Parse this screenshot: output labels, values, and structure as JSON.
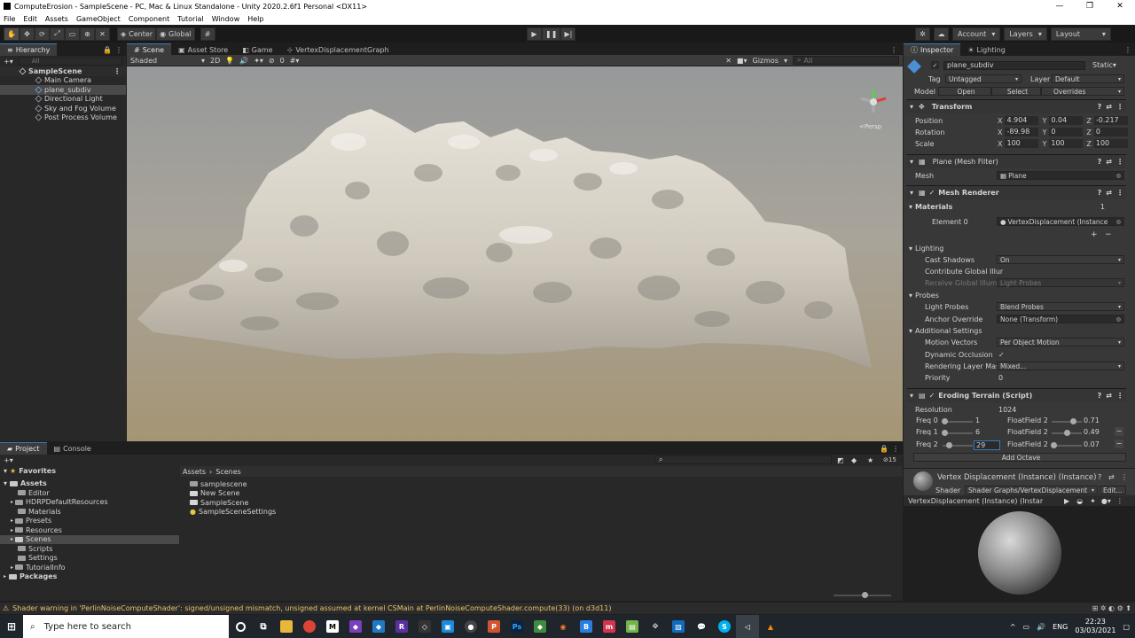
{
  "window": {
    "title": "ComputeErosion - SampleScene - PC, Mac & Linux Standalone - Unity 2020.2.6f1 Personal <DX11>"
  },
  "menu": [
    "File",
    "Edit",
    "Assets",
    "GameObject",
    "Component",
    "Tutorial",
    "Window",
    "Help"
  ],
  "toolbar": {
    "pivot": "Center",
    "space": "Global",
    "account": "Account",
    "layers": "Layers",
    "layout": "Layout"
  },
  "hierarchy": {
    "tab": "Hierarchy",
    "search": "All",
    "scene": "SampleScene",
    "items": [
      "Main Camera",
      "plane_subdiv",
      "Directional Light",
      "Sky and Fog Volume",
      "Post Process Volume"
    ]
  },
  "scene_tabs": [
    "Scene",
    "Asset Store",
    "Game",
    "VertexDisplacementGraph"
  ],
  "scene_toolbar": {
    "shading": "Shaded",
    "mode": "2D",
    "layers_count": "0",
    "gizmos": "Gizmos",
    "search": "All",
    "persp": "<Persp"
  },
  "project": {
    "tabs": [
      "Project",
      "Console"
    ],
    "favorites": "Favorites",
    "assets": "Assets",
    "folders": [
      "Editor",
      "HDRPDefaultResources",
      "Materials",
      "Presets",
      "Resources",
      "Scenes",
      "Scripts",
      "Settings",
      "TutorialInfo"
    ],
    "packages": "Packages",
    "breadcrumb": [
      "Assets",
      "Scenes"
    ],
    "files": [
      "samplescene",
      "New Scene",
      "SampleScene",
      "SampleSceneSettings"
    ],
    "count": "15"
  },
  "inspector": {
    "tabs": [
      "Inspector",
      "Lighting"
    ],
    "object": "plane_subdiv",
    "static": "Static",
    "tag_label": "Tag",
    "tag": "Untagged",
    "layer_label": "Layer",
    "layer": "Default",
    "model_label": "Model",
    "open": "Open",
    "select": "Select",
    "overrides": "Overrides",
    "transform": {
      "title": "Transform",
      "rows": [
        {
          "label": "Position",
          "x": "4.904",
          "y": "0.04",
          "z": "-0.217"
        },
        {
          "label": "Rotation",
          "x": "-89.98",
          "y": "0",
          "z": "0"
        },
        {
          "label": "Scale",
          "x": "100",
          "y": "100",
          "z": "100"
        }
      ]
    },
    "meshfilter": {
      "title": "Plane (Mesh Filter)",
      "mesh_label": "Mesh",
      "mesh": "Plane"
    },
    "renderer": {
      "title": "Mesh Renderer",
      "materials": "Materials",
      "mat_count": "1",
      "element": "Element 0",
      "element_val": "VertexDisplacement (Instance",
      "lighting": "Lighting",
      "cast_shadows": "Cast Shadows",
      "cast_val": "On",
      "contribute": "Contribute Global Illur",
      "receive": "Receive Global Illumi",
      "receive_val": "Light Probes",
      "probes": "Probes",
      "light_probes": "Light Probes",
      "lp_val": "Blend Probes",
      "anchor": "Anchor Override",
      "anchor_val": "None (Transform)",
      "additional": "Additional Settings",
      "motion": "Motion Vectors",
      "motion_val": "Per Object Motion",
      "dynocc": "Dynamic Occlusion",
      "rlm": "Rendering Layer Mas",
      "rlm_val": "Mixed...",
      "priority": "Priority",
      "priority_val": "0"
    },
    "script": {
      "title": "Eroding Terrain (Script)",
      "res_label": "Resolution",
      "res": "1024",
      "freqs": [
        {
          "label": "Freq 0",
          "val": "1",
          "ff": "FloatField 2",
          "ffv": "0.71",
          "s": 0.05,
          "fs": 0.71
        },
        {
          "label": "Freq 1",
          "val": "6",
          "ff": "FloatField 2",
          "ffv": "0.49",
          "s": 0.05,
          "fs": 0.49
        },
        {
          "label": "Freq 2",
          "val": "29",
          "ff": "FloatField 2",
          "ffv": "0.07",
          "s": 0.2,
          "fs": 0.07
        }
      ],
      "add": "Add Octave"
    },
    "material": {
      "title": "Vertex Displacement (Instance) (Instance)",
      "shader_label": "Shader",
      "shader": "Shader Graphs/VertexDisplacement",
      "edit": "Edit..."
    },
    "preview": "VertexDisplacement (Instance) (Instar"
  },
  "status": "Shader warning in 'PerlinNoiseComputeShader': signed/unsigned mismatch, unsigned assumed at kernel CSMain at PerlinNoiseComputeShader.compute(33) (on d3d11)",
  "taskbar": {
    "search": "Type here to search",
    "lang": "ENG",
    "time": "22:23",
    "date": "03/03/2021"
  }
}
